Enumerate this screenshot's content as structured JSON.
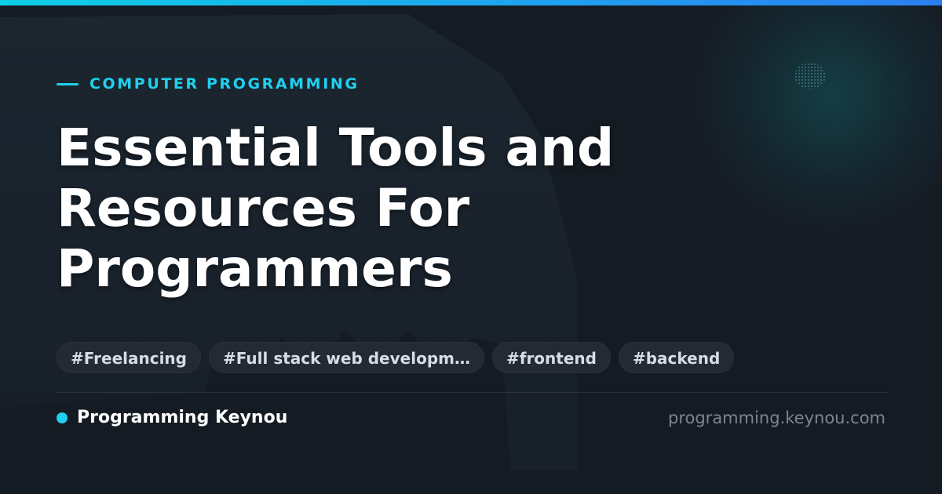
{
  "category": "COMPUTER PROGRAMMING",
  "title": "Essential Tools and Resources For Programmers",
  "tags": [
    "#Freelancing",
    "#Full stack web developm…",
    "#frontend",
    "#backend"
  ],
  "brand": {
    "name": "Programming Keynou"
  },
  "site_url": "programming.keynou.com",
  "colors": {
    "accent": "#1fd1ef",
    "background": "#151b23",
    "tag_background": "#232a34",
    "muted_text": "#7c8591"
  }
}
